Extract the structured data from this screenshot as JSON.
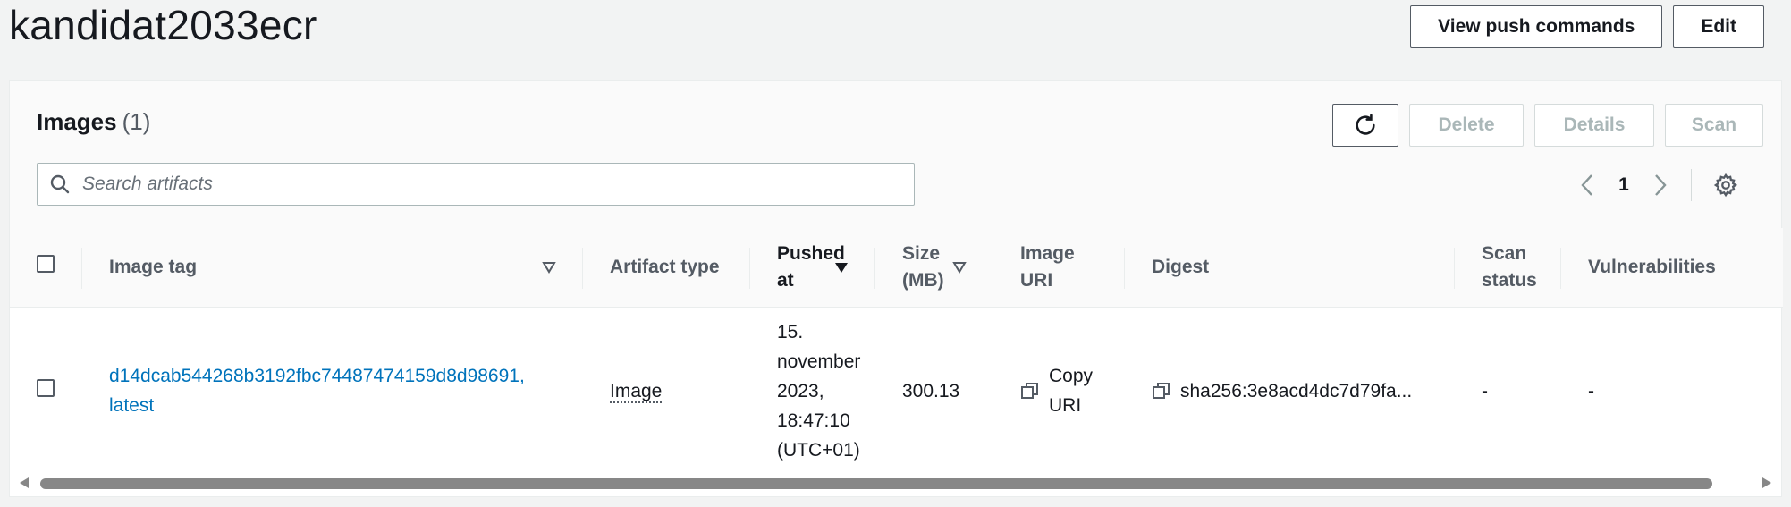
{
  "header": {
    "title": "kandidat2033ecr",
    "view_push_label": "View push commands",
    "edit_label": "Edit"
  },
  "images_panel": {
    "title": "Images",
    "count": "(1)",
    "delete_label": "Delete",
    "details_label": "Details",
    "scan_label": "Scan",
    "search_placeholder": "Search artifacts",
    "page": "1"
  },
  "table": {
    "columns": {
      "image_tag": "Image tag",
      "artifact_type": "Artifact type",
      "pushed_at": "Pushed at",
      "size": "Size (MB)",
      "image_uri": "Image URI",
      "digest": "Digest",
      "scan_status": "Scan status",
      "vulnerabilities": "Vulnerabilities"
    },
    "rows": [
      {
        "image_tag": "d14dcab544268b3192fbc74487474159d8d98691, latest",
        "artifact_type": "Image",
        "pushed_at": "15. november 2023, 18:47:10 (UTC+01)",
        "size": "300.13",
        "image_uri": "Copy URI",
        "digest": "sha256:3e8acd4dc7d79fa...",
        "scan_status": "-",
        "vulnerabilities": "-"
      }
    ]
  },
  "colors": {
    "link": "#0073bb",
    "border": "#545b64",
    "disabled": "#aab7b8"
  }
}
